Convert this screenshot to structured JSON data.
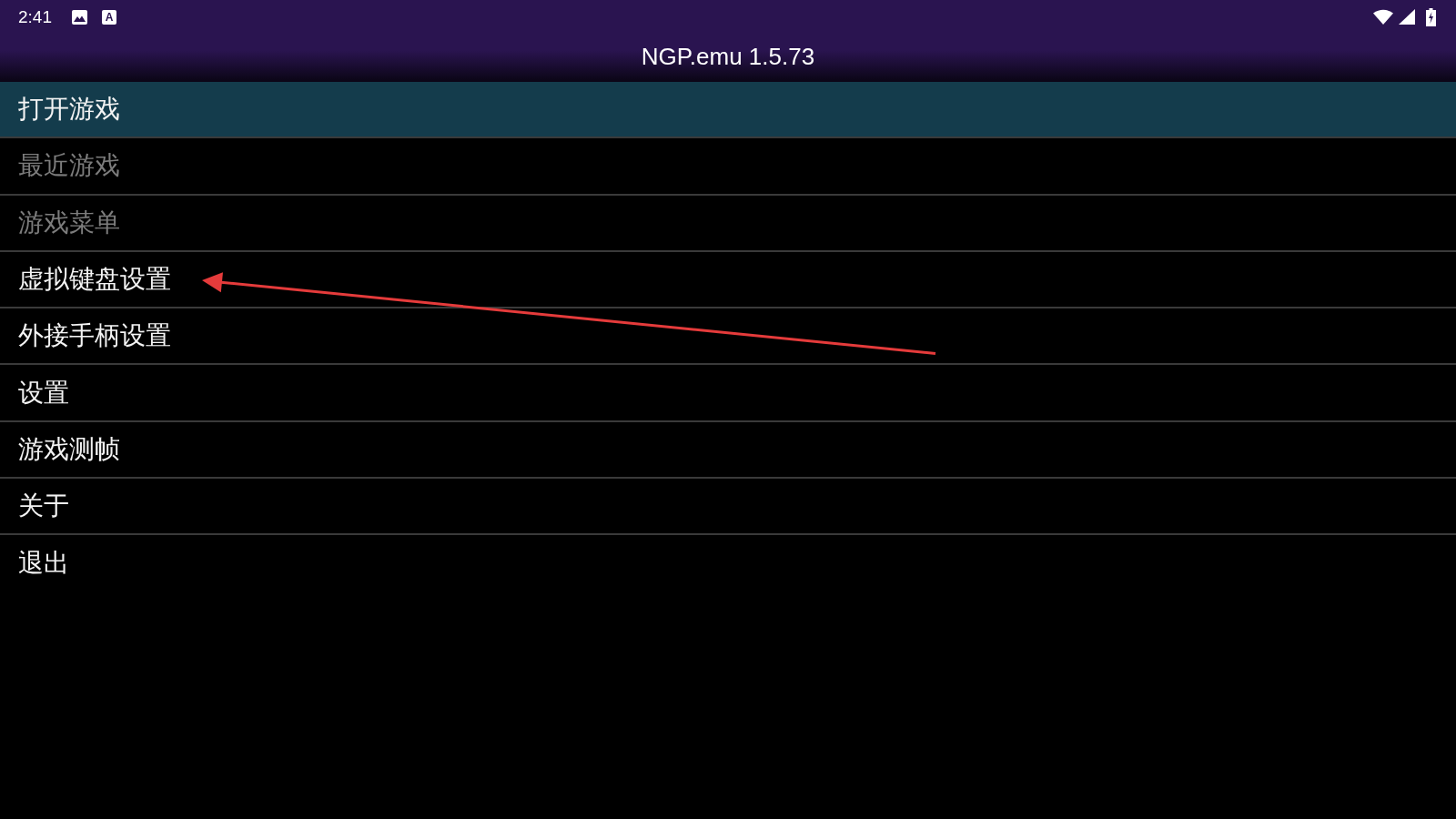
{
  "status_bar": {
    "time": "2:41",
    "input_indicator": "A"
  },
  "title_bar": {
    "title": "NGP.emu 1.5.73"
  },
  "menu": {
    "items": [
      {
        "label": "打开游戏",
        "selected": true,
        "disabled": false,
        "marked_by_arrow": false
      },
      {
        "label": "最近游戏",
        "selected": false,
        "disabled": true,
        "marked_by_arrow": false
      },
      {
        "label": "游戏菜单",
        "selected": false,
        "disabled": true,
        "marked_by_arrow": false
      },
      {
        "label": "虚拟键盘设置",
        "selected": false,
        "disabled": false,
        "marked_by_arrow": true
      },
      {
        "label": "外接手柄设置",
        "selected": false,
        "disabled": false,
        "marked_by_arrow": false
      },
      {
        "label": "设置",
        "selected": false,
        "disabled": false,
        "marked_by_arrow": false
      },
      {
        "label": "游戏测帧",
        "selected": false,
        "disabled": false,
        "marked_by_arrow": false
      },
      {
        "label": "关于",
        "selected": false,
        "disabled": false,
        "marked_by_arrow": false
      },
      {
        "label": "退出",
        "selected": false,
        "disabled": false,
        "marked_by_arrow": false
      }
    ]
  }
}
